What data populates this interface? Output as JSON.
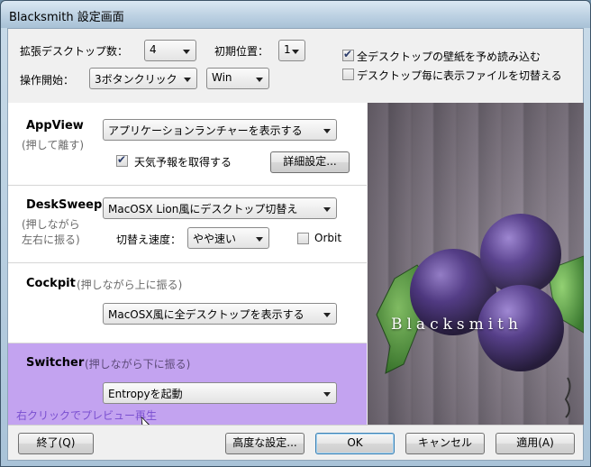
{
  "window": {
    "title": "Blacksmith 設定画面"
  },
  "top": {
    "desktops_label": "拡張デスクトップ数：",
    "desktops_value": "4",
    "initial_pos_label": "初期位置：",
    "initial_pos_value": "1",
    "op_start_label": "操作開始：",
    "op_start_value": "3ボタンクリック",
    "op_key_value": "Win",
    "preload_label": "全デスクトップの壁紙を予め読み込む",
    "preload_checked": true,
    "switchfile_label": "デスクトップ毎に表示ファイルを切替える",
    "switchfile_checked": false
  },
  "appview": {
    "name": "AppView",
    "sub": "(押して離す)",
    "action_value": "アプリケーションランチャーを表示する",
    "weather_label": "天気予報を取得する",
    "weather_checked": true,
    "detail_button": "詳細設定..."
  },
  "desksweep": {
    "name": "DeskSweep",
    "sub1": "(押しながら",
    "sub2": "左右に振る)",
    "action_value": "MacOSX Lion風にデスクトップ切替え",
    "speed_label": "切替え速度：",
    "speed_value": "やや速い",
    "orbit_label": "Orbit",
    "orbit_checked": false
  },
  "cockpit": {
    "name": "Cockpit",
    "sub": "(押しながら上に振る)",
    "action_value": "MacOSX風に全デスクトップを表示する"
  },
  "switcher": {
    "name": "Switcher",
    "sub": "(押しながら下に振る)",
    "action_value": "Entropyを起動",
    "hint": "右クリックでプレビュー再生"
  },
  "image": {
    "brand_text": "Blacksmith"
  },
  "buttons": {
    "exit": "終了(Q)",
    "advanced": "高度な設定...",
    "ok": "OK",
    "cancel": "キャンセル",
    "apply": "適用(A)"
  },
  "colors": {
    "switcher_highlight": "#c3a3f0",
    "hint_text": "#7a4fd0"
  }
}
